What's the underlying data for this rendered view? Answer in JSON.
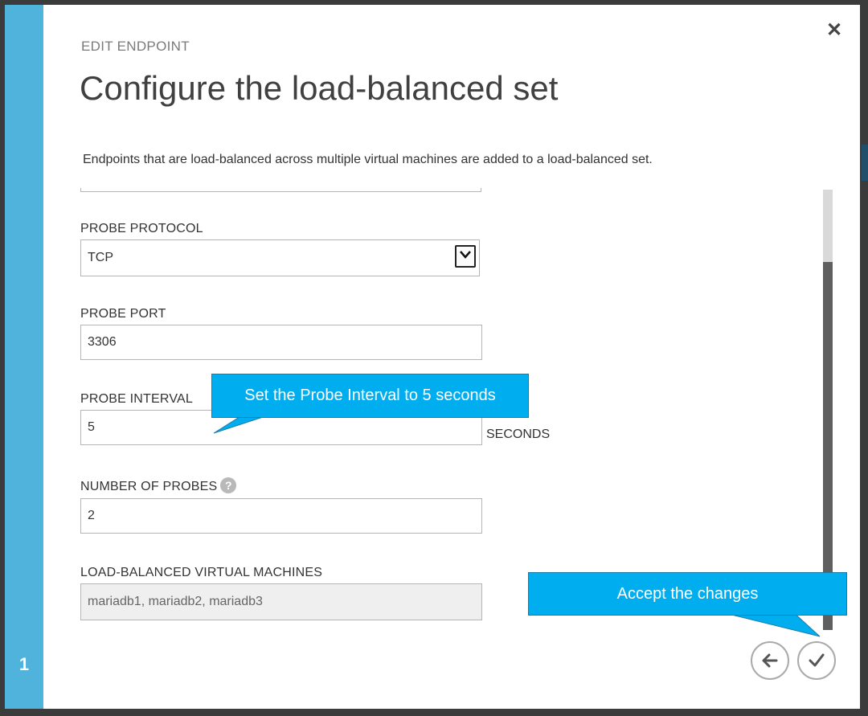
{
  "dialog": {
    "eyebrow": "EDIT ENDPOINT",
    "title": "Configure the load-balanced set",
    "description": "Endpoints that are load-balanced across multiple virtual machines are added to a load-balanced set.",
    "step_number": "1",
    "close_icon": "close-icon"
  },
  "form": {
    "probe_protocol": {
      "label": "PROBE PROTOCOL",
      "value": "TCP"
    },
    "probe_port": {
      "label": "PROBE PORT",
      "value": "3306"
    },
    "probe_interval": {
      "label": "PROBE INTERVAL",
      "value": "5",
      "unit": "SECONDS"
    },
    "number_of_probes": {
      "label": "NUMBER OF PROBES",
      "value": "2",
      "help_icon": "?"
    },
    "load_balanced_vms": {
      "label": "LOAD-BALANCED VIRTUAL MACHINES",
      "value": "mariadb1, mariadb2, mariadb3"
    }
  },
  "callouts": {
    "probe_interval": "Set the Probe Interval to 5 seconds",
    "accept": "Accept the changes"
  },
  "footer": {
    "back_icon": "arrow-left-icon",
    "confirm_icon": "checkmark-icon"
  },
  "colors": {
    "step_bar": "#4fb3dc",
    "callout": "#00aeef"
  }
}
